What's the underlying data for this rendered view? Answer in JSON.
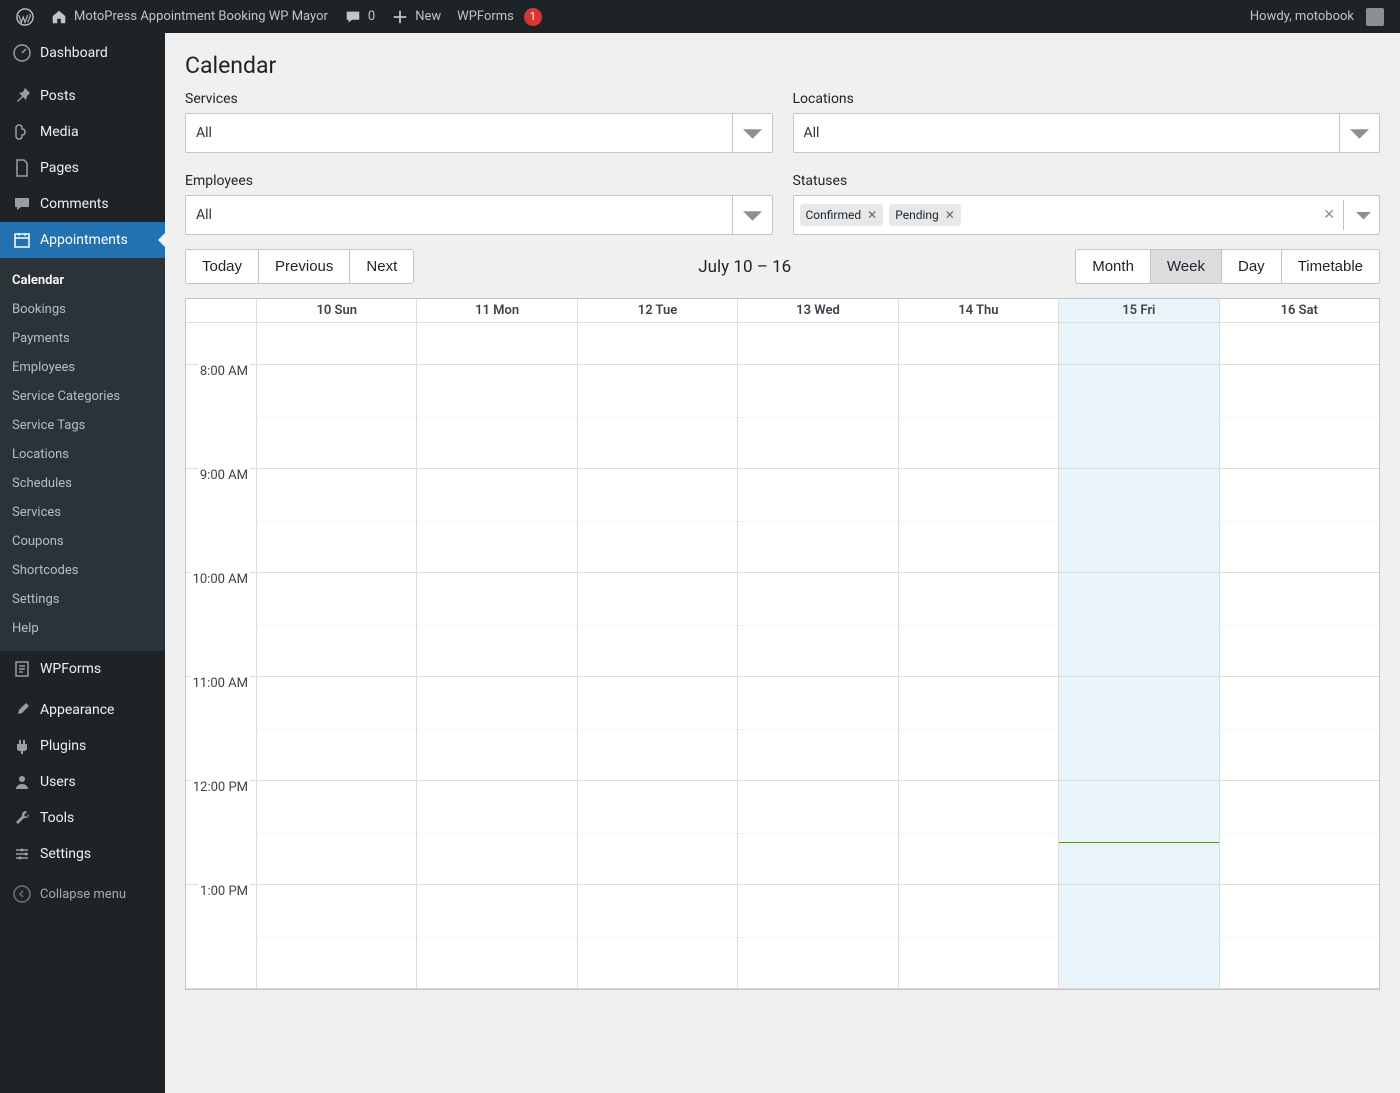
{
  "adminbar": {
    "site_title": "MotoPress Appointment Booking WP Mayor",
    "comments_count": "0",
    "new_label": "New",
    "wpforms_label": "WPForms",
    "wpforms_badge": "1",
    "howdy": "Howdy, motobook"
  },
  "sidebar": {
    "items": [
      {
        "label": "Dashboard",
        "icon": "gauge-icon"
      },
      {
        "label": "Posts",
        "icon": "pin-icon"
      },
      {
        "label": "Media",
        "icon": "media-icon"
      },
      {
        "label": "Pages",
        "icon": "page-icon"
      },
      {
        "label": "Comments",
        "icon": "comment-icon"
      },
      {
        "label": "Appointments",
        "icon": "calendar-icon"
      },
      {
        "label": "WPForms",
        "icon": "form-icon"
      },
      {
        "label": "Appearance",
        "icon": "brush-icon"
      },
      {
        "label": "Plugins",
        "icon": "plug-icon"
      },
      {
        "label": "Users",
        "icon": "user-icon"
      },
      {
        "label": "Tools",
        "icon": "wrench-icon"
      },
      {
        "label": "Settings",
        "icon": "sliders-icon"
      }
    ],
    "submenu": [
      "Calendar",
      "Bookings",
      "Payments",
      "Employees",
      "Service Categories",
      "Service Tags",
      "Locations",
      "Schedules",
      "Services",
      "Coupons",
      "Shortcodes",
      "Settings",
      "Help"
    ],
    "collapse": "Collapse menu"
  },
  "main": {
    "title": "Calendar",
    "filters": {
      "services": {
        "label": "Services",
        "value": "All"
      },
      "locations": {
        "label": "Locations",
        "value": "All"
      },
      "employees": {
        "label": "Employees",
        "value": "All"
      },
      "statuses": {
        "label": "Statuses",
        "tags": [
          "Confirmed",
          "Pending"
        ]
      }
    },
    "nav": {
      "today": "Today",
      "previous": "Previous",
      "next": "Next"
    },
    "date_range": "July 10 – 16",
    "views": [
      "Month",
      "Week",
      "Day",
      "Timetable"
    ],
    "active_view": "Week",
    "days": [
      {
        "label": "10 Sun",
        "today": false
      },
      {
        "label": "11 Mon",
        "today": false
      },
      {
        "label": "12 Tue",
        "today": false
      },
      {
        "label": "13 Wed",
        "today": false
      },
      {
        "label": "14 Thu",
        "today": false
      },
      {
        "label": "15 Fri",
        "today": true
      },
      {
        "label": "16 Sat",
        "today": false
      }
    ],
    "time_labels": [
      "8:00 AM",
      "9:00 AM",
      "10:00 AM",
      "11:00 AM",
      "12:00 PM",
      "1:00 PM"
    ],
    "now_line_percent": 59
  }
}
